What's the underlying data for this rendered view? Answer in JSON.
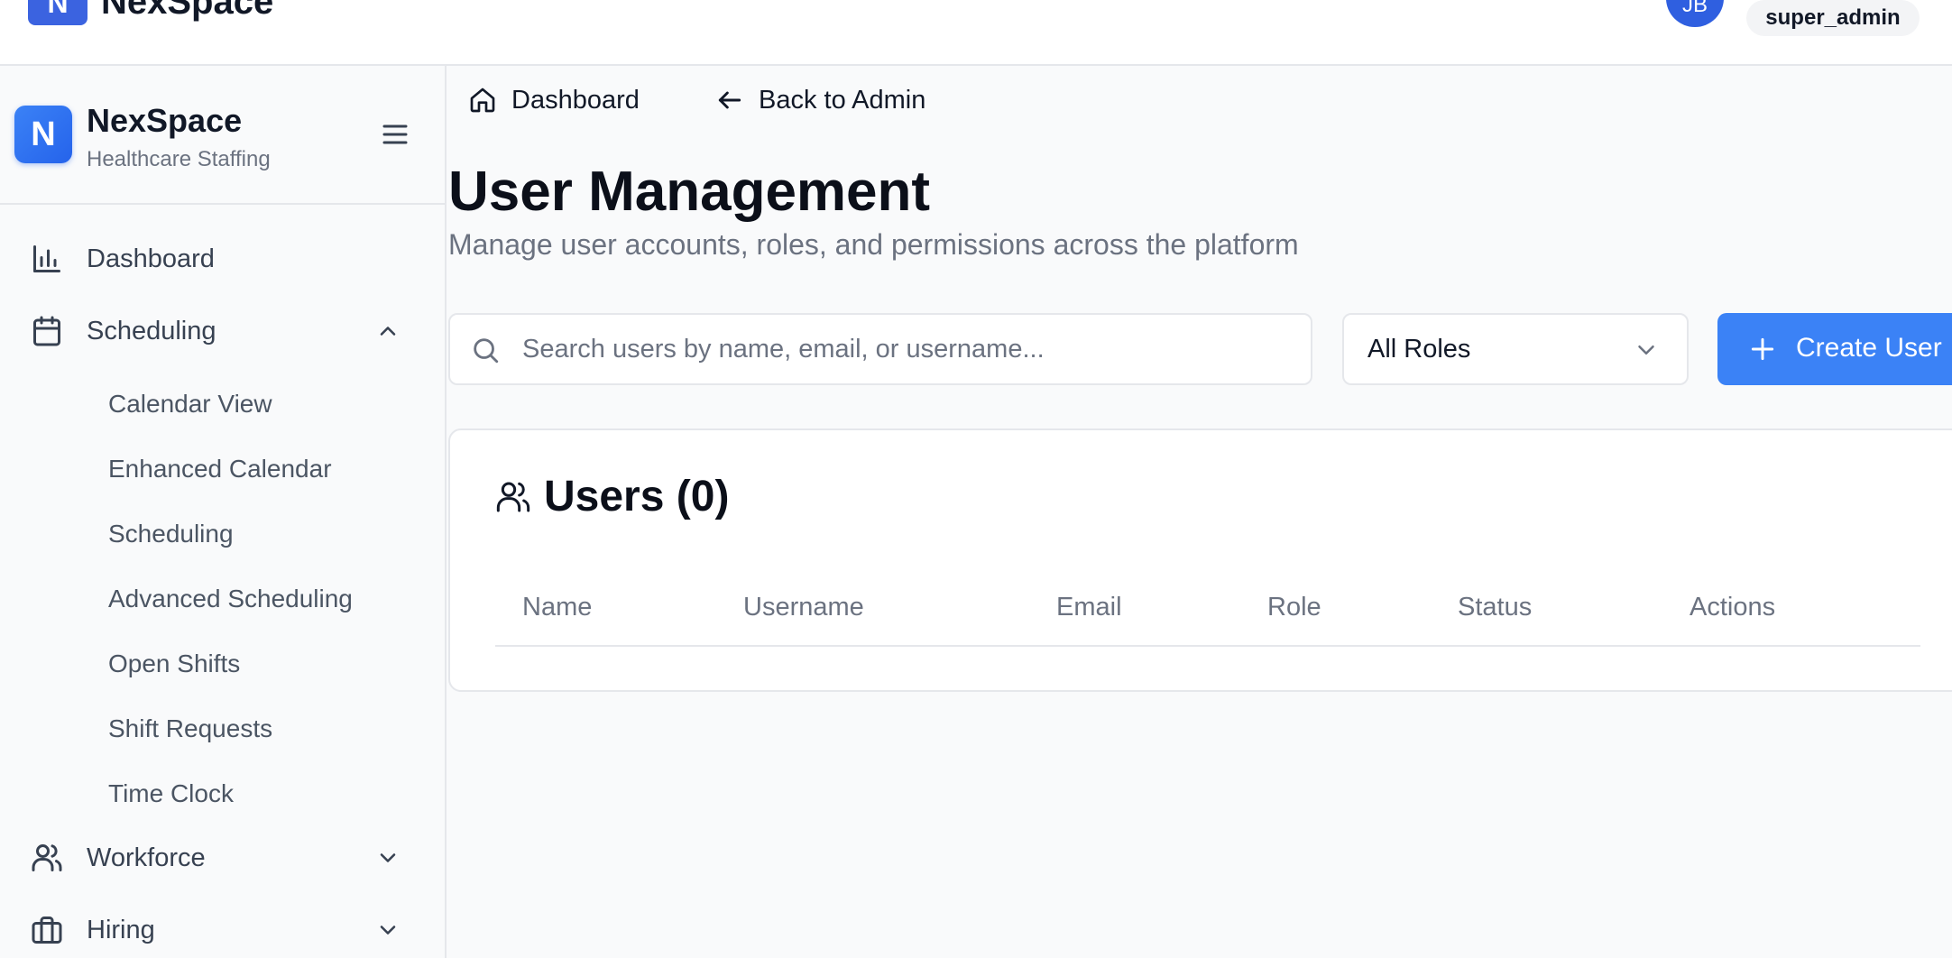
{
  "topbar": {
    "logo_letter": "N",
    "brand": "NexSpace",
    "avatar_initials": "JB",
    "role_badge": "super_admin"
  },
  "sidebar": {
    "logo_letter": "N",
    "title": "NexSpace",
    "subtitle": "Healthcare Staffing",
    "items": [
      {
        "label": "Dashboard",
        "icon": "bar-chart-icon"
      },
      {
        "label": "Scheduling",
        "icon": "calendar-icon",
        "expanded": true,
        "children": [
          "Calendar View",
          "Enhanced Calendar",
          "Scheduling",
          "Advanced Scheduling",
          "Open Shifts",
          "Shift Requests",
          "Time Clock"
        ]
      },
      {
        "label": "Workforce",
        "icon": "users-icon",
        "expanded": false
      },
      {
        "label": "Hiring",
        "icon": "briefcase-icon",
        "expanded": false
      }
    ]
  },
  "breadcrumb": {
    "dashboard": "Dashboard",
    "back": "Back to Admin"
  },
  "page": {
    "title": "User Management",
    "subtitle": "Manage user accounts, roles, and permissions across the platform"
  },
  "toolbar": {
    "search_placeholder": "Search users by name, email, or username...",
    "search_value": "",
    "role_filter": "All Roles",
    "create_label": "Create User"
  },
  "users_card": {
    "title": "Users (0)",
    "columns": [
      "Name",
      "Username",
      "Email",
      "Role",
      "Status",
      "Actions"
    ],
    "rows": []
  },
  "colors": {
    "accent": "#3b82f6",
    "avatar": "#2f5fe0",
    "muted_text": "#6b7280"
  }
}
